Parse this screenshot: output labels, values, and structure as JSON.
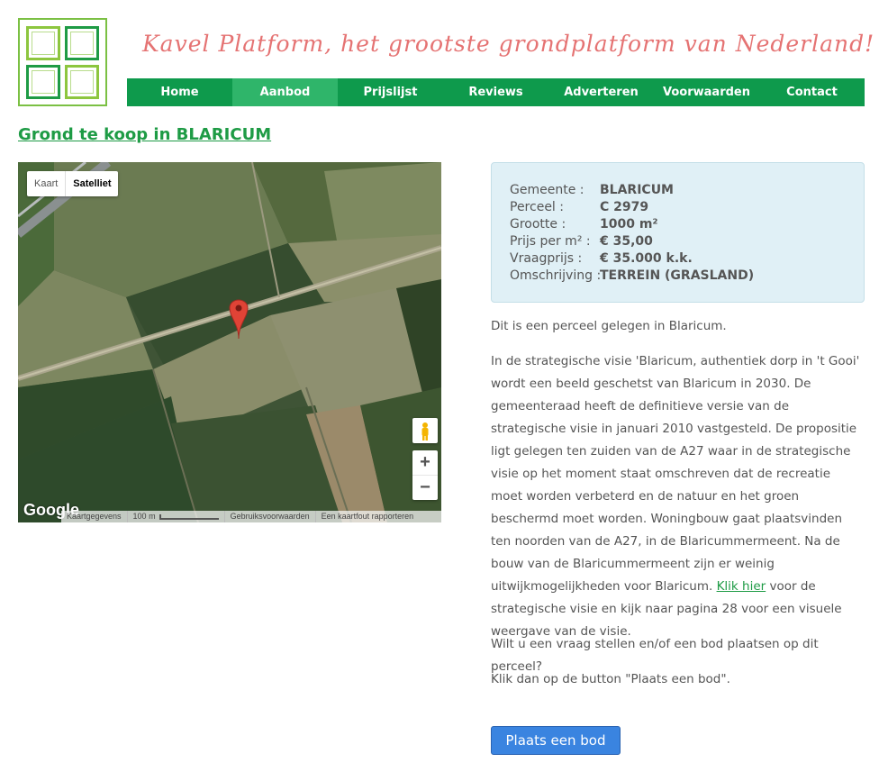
{
  "header": {
    "tagline": "Kavel Platform, het grootste grondplatform van Nederland!"
  },
  "nav": {
    "items": [
      {
        "label": "Home"
      },
      {
        "label": "Aanbod"
      },
      {
        "label": "Prijslijst"
      },
      {
        "label": "Reviews"
      },
      {
        "label": "Adverteren"
      },
      {
        "label": "Voorwaarden"
      },
      {
        "label": "Contact"
      }
    ],
    "active": "Aanbod"
  },
  "page": {
    "title": "Grond te koop in BLARICUM"
  },
  "map": {
    "toggle_map": "Kaart",
    "toggle_satellite": "Satelliet",
    "zoom_in": "+",
    "zoom_out": "−",
    "logo": "Google",
    "footer": {
      "map_data": "Kaartgegevens",
      "scale": "100 m",
      "terms": "Gebruiksvoorwaarden",
      "report": "Een kaartfout rapporteren"
    }
  },
  "details": {
    "rows": [
      {
        "label": "Gemeente :",
        "value": "BLARICUM"
      },
      {
        "label": "Perceel :",
        "value": "C 2979"
      },
      {
        "label": "Grootte :",
        "value": "1000  m²"
      },
      {
        "label": "Prijs per m² :",
        "value": "€ 35,00"
      },
      {
        "label": "Vraagprijs :",
        "value": "€ 35.000 k.k."
      },
      {
        "label": "Omschrijving :",
        "value": "TERREIN (GRASLAND)"
      }
    ]
  },
  "description": {
    "intro": "Dit is een perceel gelegen in Blaricum.",
    "body_before_link": "In de strategische visie 'Blaricum, authentiek dorp in 't Gooi' wordt een beeld geschetst van Blaricum in 2030. De gemeenteraad heeft de definitieve versie van de strategische visie in januari 2010 vastgesteld. De propositie ligt gelegen ten zuiden van de A27 waar in de strategische visie op het moment staat omschreven dat de recreatie moet worden verbeterd en de natuur en het groen beschermd moet worden. Woningbouw gaat plaatsvinden ten noorden van de A27, in de Blaricummermeent. Na de bouw van de Blaricummermeent zijn er weinig uitwijkmogelijkheden voor Blaricum.",
    "link_text": "Klik hier",
    "body_after_link": "voor de strategische visie en kijk naar pagina 28 voor een visuele weergave van de visie.",
    "question": "Wilt u een vraag stellen en/of een bod plaatsen op dit perceel?",
    "instruction": "Klik dan op de button \"Plaats een bod\"."
  },
  "actions": {
    "bid_label": "Plaats een bod"
  },
  "colors": {
    "brand_green": "#0e9a4c",
    "active_nav": "#2fb56a",
    "tagline": "#e57373",
    "button_blue": "#3a84e0"
  }
}
